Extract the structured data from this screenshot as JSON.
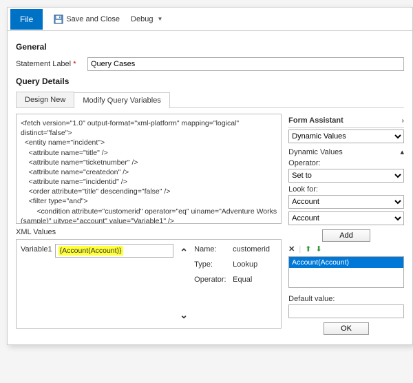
{
  "toolbar": {
    "file": "File",
    "save_close": "Save and Close",
    "debug": "Debug"
  },
  "general": {
    "title": "General",
    "label_text": "Statement Label",
    "statement_value": "Query Cases"
  },
  "query": {
    "title": "Query Details",
    "tabs": {
      "design": "Design New",
      "modify": "Modify Query Variables"
    },
    "xml": "<fetch version=\"1.0\" output-format=\"xml-platform\" mapping=\"logical\"\ndistinct=\"false\">\n  <entity name=\"incident\">\n    <attribute name=\"title\" />\n    <attribute name=\"ticketnumber\" />\n    <attribute name=\"createdon\" />\n    <attribute name=\"incidentid\" />\n    <order attribute=\"title\" descending=\"false\" />\n    <filter type=\"and\">\n        <condition attribute=\"customerid\" operator=\"eq\" uiname=\"Adventure Works\n(sample)\" uitype=\"account\" value=\"Variable1\" />\n      </filter>\n    </entity>\n</fetch>",
    "xml_values_label": "XML Values",
    "variable_label": "Variable1",
    "variable_value": "{Account(Account)}",
    "meta": {
      "name_label": "Name:",
      "name_value": "customerid",
      "type_label": "Type:",
      "type_value": "Lookup",
      "op_label": "Operator:",
      "op_value": "Equal"
    }
  },
  "assistant": {
    "title": "Form Assistant",
    "dyn_values": "Dynamic Values",
    "dyn_sub": "Dynamic Values",
    "operator_label": "Operator:",
    "operator_value": "Set to",
    "lookfor_label": "Look for:",
    "lookfor_entity": "Account",
    "lookfor_field": "Account",
    "add": "Add",
    "token": "Account(Account)",
    "default_label": "Default value:",
    "default_value": "",
    "ok": "OK"
  }
}
